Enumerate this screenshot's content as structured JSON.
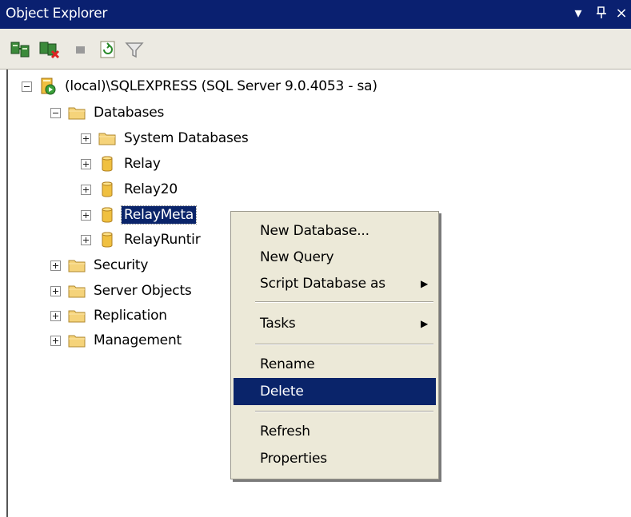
{
  "window": {
    "title": "Object Explorer",
    "buttons": {
      "dropdown": "▾",
      "pin": "ꟷ",
      "close": "×"
    }
  },
  "toolbar": {
    "tools": [
      {
        "icon": "connect-icon"
      },
      {
        "icon": "disconnect-icon"
      },
      {
        "icon": "stop-icon"
      },
      {
        "icon": "refresh-icon"
      },
      {
        "icon": "filter-icon"
      }
    ]
  },
  "tree": {
    "server": "(local)\\SQLEXPRESS (SQL Server 9.0.4053 - sa)",
    "databases": "Databases",
    "system_databases": "System Databases",
    "db_relay": "Relay",
    "db_relay20": "Relay20",
    "db_relaymeta": "RelayMeta",
    "db_relayruntime": "RelayRuntir",
    "security": "Security",
    "server_objects": "Server Objects",
    "replication": "Replication",
    "management": "Management"
  },
  "context_menu": {
    "new_database": "New Database...",
    "new_query": "New Query",
    "script_database_as": "Script Database as",
    "tasks": "Tasks",
    "rename": "Rename",
    "delete": "Delete",
    "refresh": "Refresh",
    "properties": "Properties",
    "submenu_arrow": "▶"
  },
  "colors": {
    "titlebar": "#0a2070",
    "selection": "#0a246a",
    "menu_bg": "#ece9d8",
    "folder": "#f5d37a",
    "database": "#f0c040"
  }
}
